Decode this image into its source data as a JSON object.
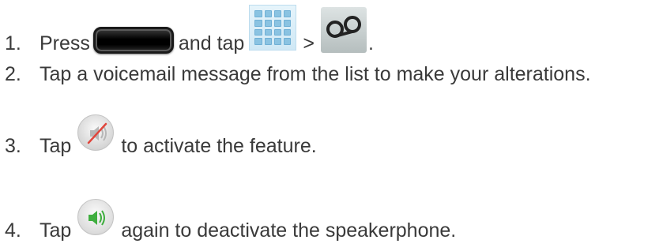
{
  "steps": [
    {
      "number": "1.",
      "parts": [
        "Press",
        "and tap",
        ">",
        "."
      ],
      "icons": [
        "home-key-icon",
        "apps-grid-icon",
        "voicemail-icon"
      ]
    },
    {
      "number": "2.",
      "text": "Tap a voicemail message from the list to make your alterations."
    },
    {
      "number": "3.",
      "parts": [
        "Tap",
        "to activate the feature."
      ],
      "icons": [
        "speaker-off-icon"
      ]
    },
    {
      "number": "4.",
      "parts": [
        "Tap",
        "again to deactivate the speakerphone."
      ],
      "icons": [
        "speaker-on-icon"
      ]
    }
  ],
  "colors": {
    "text": "#3a3a3a",
    "apps_icon_tile": "#8ac3e2",
    "speaker_on_green": "#3fae3f",
    "speaker_off_slash": "#e0463c"
  }
}
